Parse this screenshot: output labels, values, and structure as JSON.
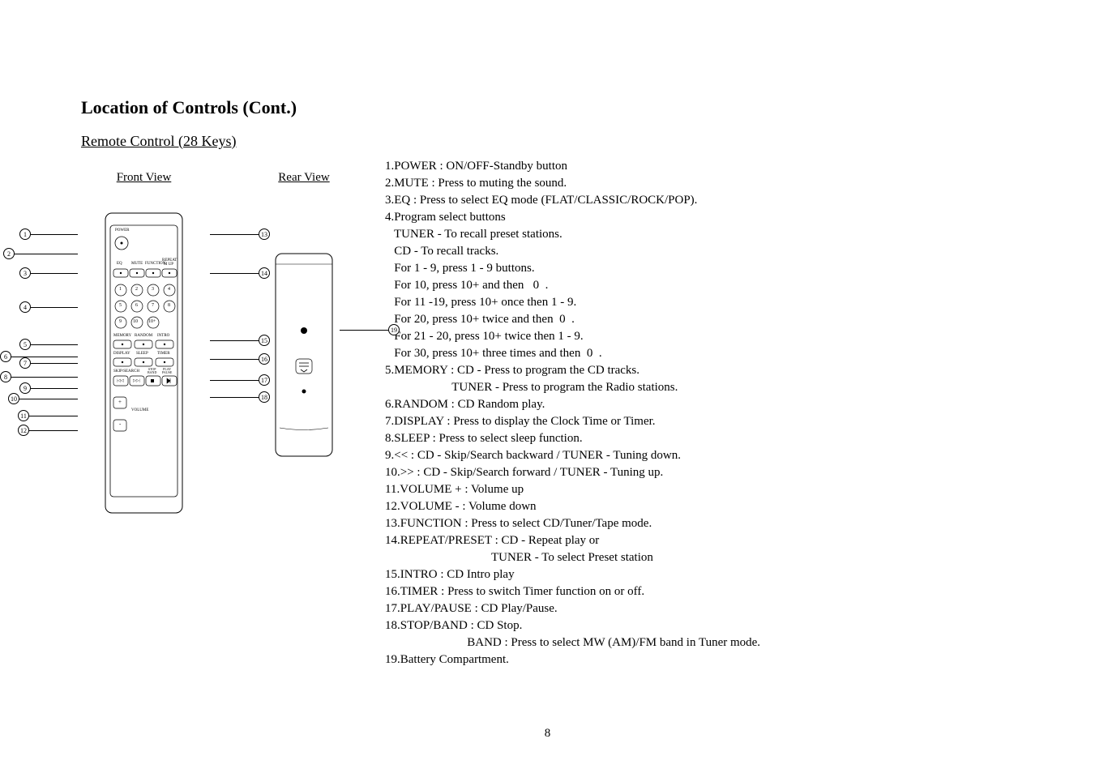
{
  "title": "Location of Controls (Cont.)",
  "subtitle": "Remote Control (28 Keys)",
  "frontViewLabel": "Front View",
  "rearViewLabel": "Rear View",
  "callouts": {
    "c1": "1",
    "c2": "2",
    "c3": "3",
    "c4": "4",
    "c5": "5",
    "c6": "6",
    "c7": "7",
    "c8": "8",
    "c9": "9",
    "c10": "10",
    "c11": "11",
    "c12": "12",
    "c13": "13",
    "c14": "14",
    "c15": "15",
    "c16": "16",
    "c17": "17",
    "c18": "18",
    "c19": "19"
  },
  "remote": {
    "power": "POWER",
    "eq": "EQ",
    "mute": "MUTE",
    "function": "FUNCTION",
    "repeat": "REPEAT",
    "mup": "M UP",
    "n1": "1",
    "n2": "2",
    "n3": "3",
    "n4": "4",
    "n5": "5",
    "n6": "6",
    "n7": "7",
    "n8": "8",
    "n9": "9",
    "n10": "10",
    "n10p": "10+",
    "memory": "MEMORY",
    "random": "RANDOM",
    "intro": "INTRO",
    "display": "DISPLAY",
    "sleep": "SLEEP",
    "timer": "TIMER",
    "skipsearch": "SKIP/SEARCH",
    "stopband": "STOP\nBAND",
    "playpause": "PLAY\nPAUSE",
    "volume": "VOLUME",
    "plus": "+",
    "minus": "-"
  },
  "desc": {
    "l1": "1.POWER : ON/OFF-Standby button",
    "l2": "2.MUTE : Press to muting the sound.",
    "l3": "3.EQ : Press to select EQ mode (FLAT/CLASSIC/ROCK/POP).",
    "l4": "4.Program select buttons",
    "l5": "   TUNER - To recall preset stations.",
    "l6": "   CD - To recall tracks.",
    "l7": "   For 1 - 9, press 1 - 9 buttons.",
    "l8": "   For 10, press 10+ and then   0  .",
    "l9": "   For 11 -19, press 10+ once then 1 - 9.",
    "l10": "   For 20, press 10+ twice and then  0  .",
    "l11": "   For 21 - 20, press 10+ twice then 1 - 9.",
    "l12": "   For 30, press 10+ three times and then  0  .",
    "l13": "5.MEMORY : CD - Press to program the CD tracks.",
    "l14": "                      TUNER - Press to program the Radio stations.",
    "l15": "6.RANDOM : CD Random play.",
    "l16": "7.DISPLAY : Press to display the Clock Time or Timer.",
    "l17": "8.SLEEP : Press to select sleep function.",
    "l18": "9.<< : CD - Skip/Search backward / TUNER - Tuning down.",
    "l19": "10.>> : CD - Skip/Search forward / TUNER - Tuning up.",
    "l20": "11.VOLUME + : Volume up",
    "l21": "12.VOLUME - : Volume down",
    "l22": "13.FUNCTION : Press to select CD/Tuner/Tape mode.",
    "l23": "14.REPEAT/PRESET : CD - Repeat play or",
    "l24": "                                   TUNER - To select Preset station",
    "l25": "15.INTRO : CD Intro play",
    "l26": "16.TIMER : Press to switch Timer function on or off.",
    "l27": "17.PLAY/PAUSE : CD Play/Pause.",
    "l28": "18.STOP/BAND : CD Stop.",
    "l29": "                           BAND : Press to select MW (AM)/FM band in Tuner mode.",
    "l30": "19.Battery Compartment."
  },
  "pageNumber": "8"
}
